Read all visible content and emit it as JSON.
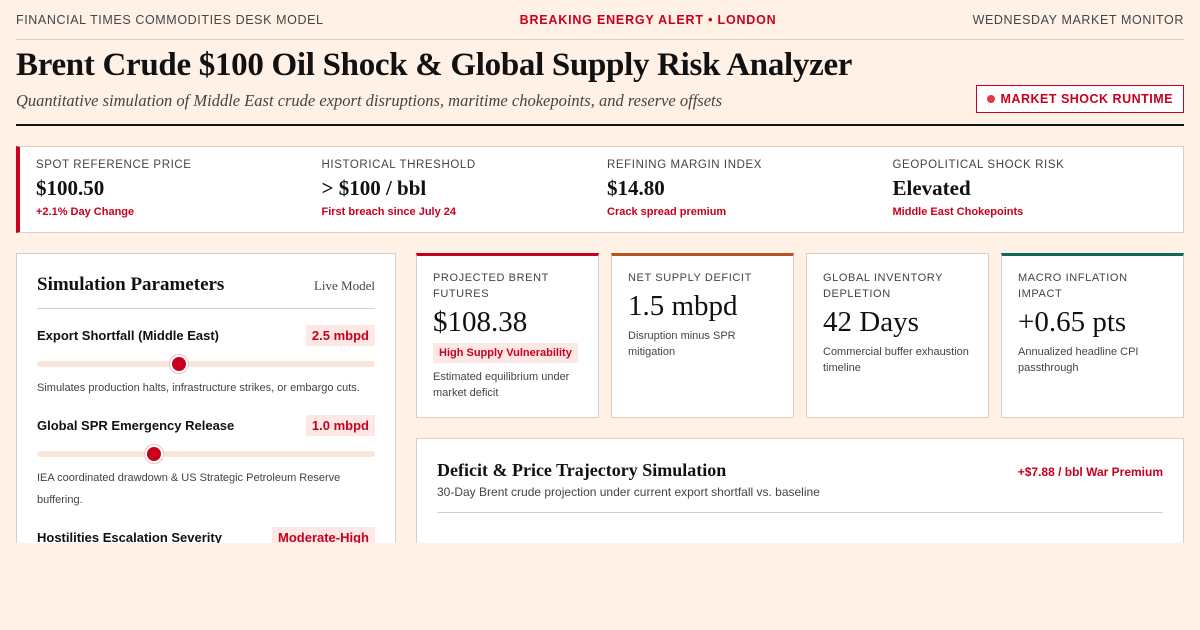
{
  "topbar": {
    "left": "FINANCIAL TIMES COMMODITIES DESK MODEL",
    "center": "BREAKING ENERGY ALERT • LONDON",
    "right": "WEDNESDAY MARKET MONITOR"
  },
  "header": {
    "title": "Brent Crude $100 Oil Shock & Global Supply Risk Analyzer",
    "subtitle": "Quantitative simulation of Middle East crude export disruptions, maritime chokepoints, and reserve offsets",
    "badge": "MARKET SHOCK RUNTIME"
  },
  "ticker": [
    {
      "label": "SPOT REFERENCE PRICE",
      "value": "$100.50",
      "sub": "+2.1% Day Change"
    },
    {
      "label": "HISTORICAL THRESHOLD",
      "value": "> $100 / bbl",
      "sub": "First breach since July 24"
    },
    {
      "label": "REFINING MARGIN INDEX",
      "value": "$14.80",
      "sub": "Crack spread premium"
    },
    {
      "label": "GEOPOLITICAL SHOCK RISK",
      "value": "Elevated",
      "sub": "Middle East Chokepoints"
    }
  ],
  "params": {
    "title": "Simulation Parameters",
    "tag": "Live Model",
    "items": [
      {
        "label": "Export Shortfall (Middle East)",
        "value": "2.5 mbpd",
        "level": 0.42,
        "desc": "Simulates production halts, infrastructure strikes, or embargo cuts."
      },
      {
        "label": "Global SPR Emergency Release",
        "value": "1.0 mbpd",
        "level": 0.345,
        "desc": "IEA coordinated drawdown & US Strategic Petroleum Reserve buffering."
      },
      {
        "label": "Hostilities Escalation Severity",
        "value": "Moderate-High"
      }
    ]
  },
  "cards": [
    {
      "label": "PROJECTED BRENT FUTURES",
      "value": "$108.38",
      "badge": "High Supply Vulnerability",
      "desc": "Estimated equilibrium under market deficit"
    },
    {
      "label": "NET SUPPLY DEFICIT",
      "value": "1.5 mbpd",
      "desc": "Disruption minus SPR mitigation"
    },
    {
      "label": "GLOBAL INVENTORY DEPLETION",
      "value": "42 Days",
      "desc": "Commercial buffer exhaustion timeline"
    },
    {
      "label": "MACRO INFLATION IMPACT",
      "value": "+0.65 pts",
      "desc": "Annualized headline CPI passthrough"
    }
  ],
  "sim": {
    "title": "Deficit & Price Trajectory Simulation",
    "subtitle": "30-Day Brent crude projection under current export shortfall vs. baseline",
    "premium": "+$7.88 / bbl War Premium"
  }
}
